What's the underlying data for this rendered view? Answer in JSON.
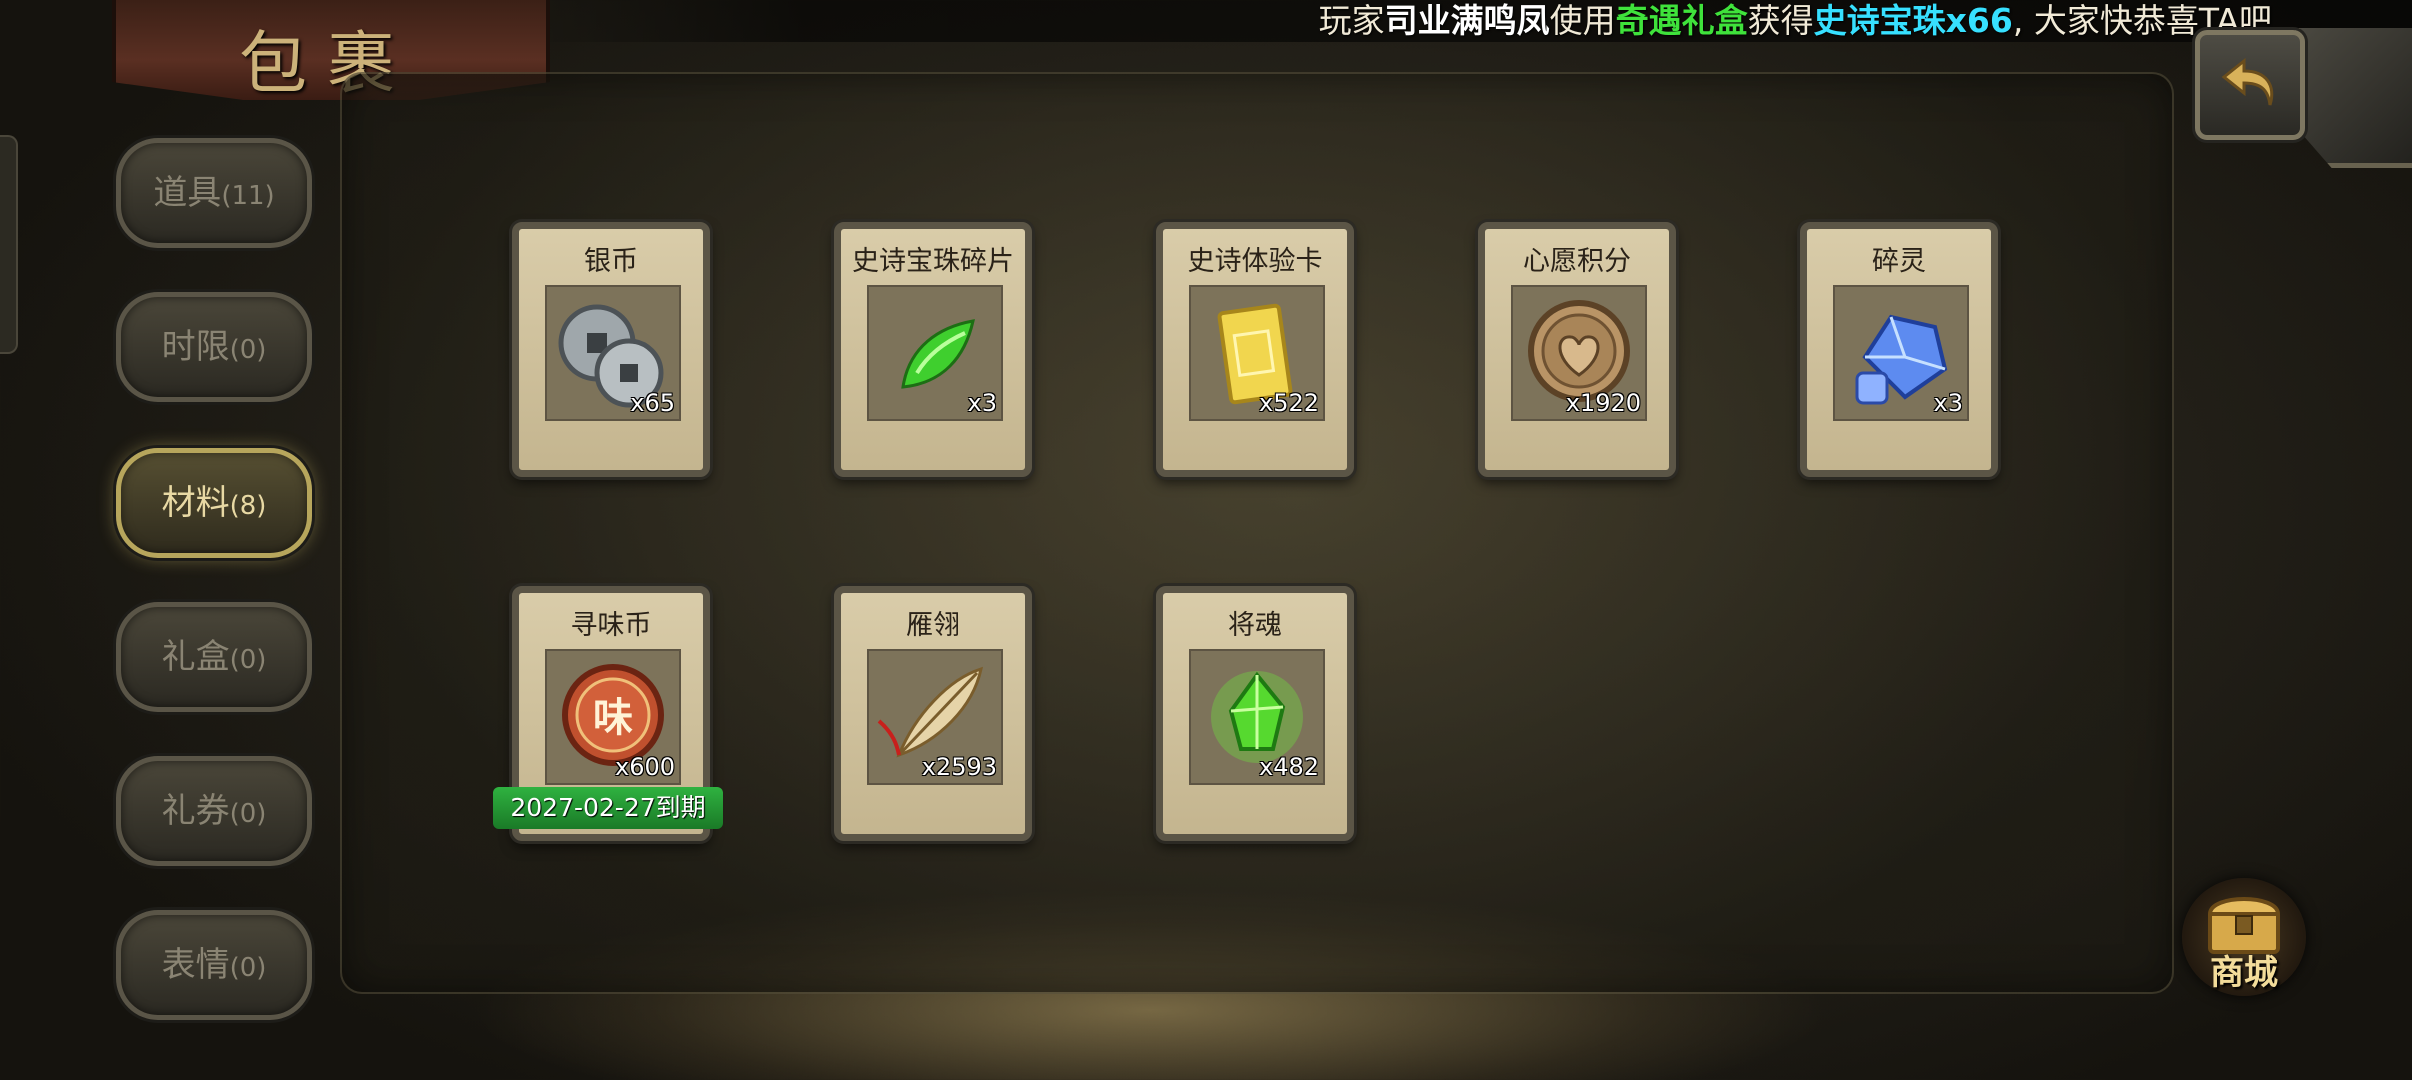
{
  "ticker": {
    "prefix": "玩家",
    "player": "司业满鸣凤",
    "middle1": "使用",
    "item_used": "奇遇礼盒",
    "middle2": "获得",
    "item_got": "史诗宝珠x66",
    "suffix": ", 大家快恭喜TA吧"
  },
  "title": "包裹",
  "tabs": [
    {
      "label": "道具",
      "count": "(11)",
      "active": false
    },
    {
      "label": "时限",
      "count": "(0)",
      "active": false
    },
    {
      "label": "材料",
      "count": "(8)",
      "active": true
    },
    {
      "label": "礼盒",
      "count": "(0)",
      "active": false
    },
    {
      "label": "礼券",
      "count": "(0)",
      "active": false
    },
    {
      "label": "表情",
      "count": "(0)",
      "active": false
    }
  ],
  "items": [
    {
      "name": "银币",
      "qty": "x65",
      "icon": "silver-coin-icon"
    },
    {
      "name": "史诗宝珠碎片",
      "qty": "x3",
      "icon": "green-gem-shard-icon"
    },
    {
      "name": "史诗体验卡",
      "qty": "x522",
      "icon": "gold-card-icon"
    },
    {
      "name": "心愿积分",
      "qty": "x1920",
      "icon": "heart-coin-icon"
    },
    {
      "name": "碎灵",
      "qty": "x3",
      "icon": "blue-crystal-icon"
    },
    {
      "name": "寻味币",
      "qty": "x600",
      "icon": "wei-coin-icon",
      "expiry": "2027-02-27到期"
    },
    {
      "name": "雁翎",
      "qty": "x2593",
      "icon": "feather-icon"
    },
    {
      "name": "将魂",
      "qty": "x482",
      "icon": "green-soul-crystal-icon"
    }
  ],
  "shop": {
    "label": "商城"
  },
  "colors": {
    "active_tab": "#b7a65c",
    "player_name": "#ffffff",
    "item_used": "#3fe23b",
    "item_got": "#37e0ff",
    "expiry_bg": "#2fb240"
  }
}
